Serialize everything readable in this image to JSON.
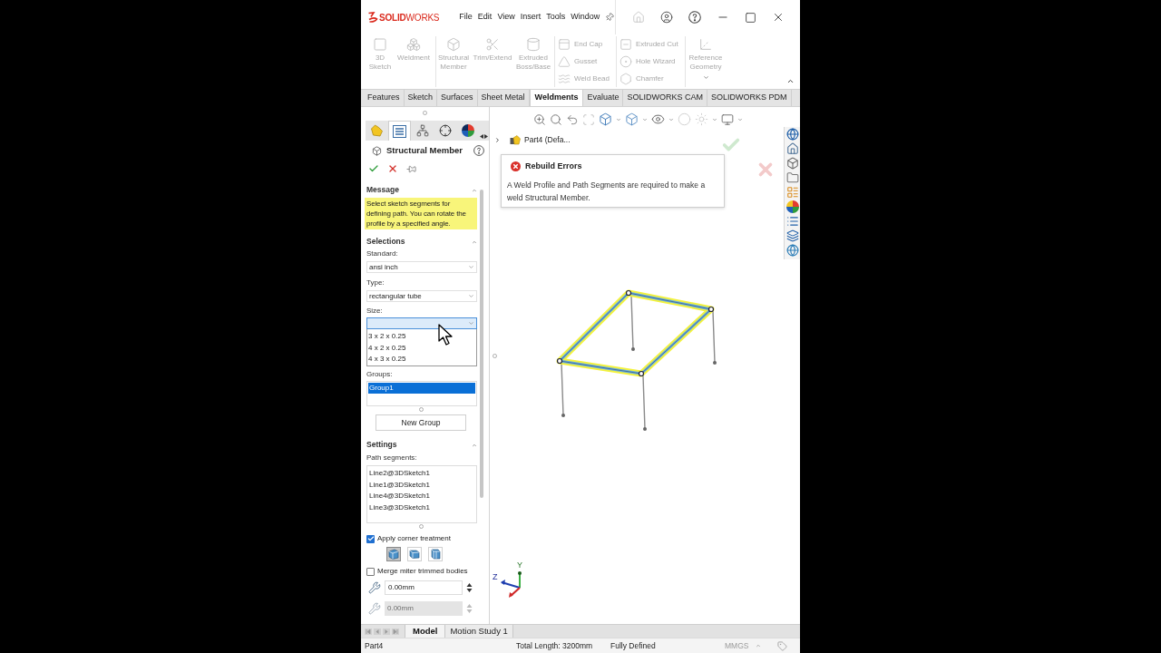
{
  "window": {
    "logo": "**SOLID**WORKS",
    "menu": [
      "File",
      "Edit",
      "View",
      "Insert",
      "Tools",
      "Window"
    ]
  },
  "command_manager": {
    "groups": [
      {
        "kind": "large",
        "tools": [
          {
            "label": "3D Sketch",
            "disabled": true,
            "dropdown": false
          },
          {
            "label": "Weldment",
            "disabled": true,
            "dropdown": false
          }
        ]
      },
      {
        "kind": "large",
        "tools": [
          {
            "label": "Structural Member",
            "disabled": true,
            "dropdown": false
          },
          {
            "label": "Trim/Extend",
            "disabled": true,
            "dropdown": false
          },
          {
            "label": "Extruded Boss/Base",
            "disabled": true,
            "dropdown": false
          }
        ]
      },
      {
        "kind": "stack",
        "tools": [
          {
            "label": "End Cap",
            "disabled": true,
            "dropdown": false
          },
          {
            "label": "Gusset",
            "disabled": true,
            "dropdown": false
          },
          {
            "label": "Weld Bead",
            "disabled": true,
            "dropdown": false
          }
        ]
      },
      {
        "kind": "stack",
        "tools": [
          {
            "label": "Extruded Cut",
            "disabled": true,
            "dropdown": false
          },
          {
            "label": "Hole Wizard",
            "disabled": true,
            "dropdown": false
          },
          {
            "label": "Chamfer",
            "disabled": true,
            "dropdown": false
          }
        ]
      },
      {
        "kind": "large",
        "tools": [
          {
            "label": "Reference Geometry",
            "disabled": true,
            "dropdown": true
          }
        ]
      }
    ],
    "tabs": [
      {
        "label": "Features",
        "selected": false
      },
      {
        "label": "Sketch",
        "selected": false
      },
      {
        "label": "Surfaces",
        "selected": false
      },
      {
        "label": "Sheet Metal",
        "selected": false
      },
      {
        "label": "Weldments",
        "selected": true
      },
      {
        "label": "Evaluate",
        "selected": false
      },
      {
        "label": "SOLIDWORKS CAM",
        "selected": false
      },
      {
        "label": "SOLIDWORKS PDM",
        "selected": false
      }
    ]
  },
  "panel": {
    "tabs": [
      {
        "kind": "feature_tree",
        "selected": false
      },
      {
        "kind": "property",
        "selected": true
      },
      {
        "kind": "configuration",
        "selected": false
      },
      {
        "kind": "dimxpert",
        "selected": false
      },
      {
        "kind": "display",
        "selected": false
      }
    ],
    "title": "Structural Member",
    "message": {
      "heading": "Message",
      "expanded": true,
      "text": "Select sketch segments for defining path. You can rotate the profile by a specified angle."
    },
    "selections": {
      "heading": "Selections",
      "expanded": true,
      "standard": {
        "label": "Standard:",
        "value": "ansi inch"
      },
      "type": {
        "label": "Type:",
        "value": "rectangular tube"
      },
      "size": {
        "label": "Size:",
        "open": true,
        "options": [
          "3 x 2 x 0.25",
          "4 x 2 x 0.25",
          "4 x 3 x 0.25"
        ]
      },
      "groups": {
        "label": "Groups:",
        "items": [
          {
            "label": "Group1",
            "selected": true
          }
        ]
      },
      "new_group_button": "New Group"
    },
    "settings": {
      "heading": "Settings",
      "expanded": true,
      "path_segments": {
        "label": "Path segments:",
        "items": [
          "Line2@3DSketch1",
          "Line1@3DSketch1",
          "Line4@3DSketch1",
          "Line3@3DSketch1"
        ]
      },
      "corner_treatment": {
        "label": "Apply corner treatment",
        "checked": true,
        "options": [
          {
            "kind": "end_miter",
            "selected": true
          },
          {
            "kind": "end_butt1",
            "selected": false
          },
          {
            "kind": "end_butt2",
            "selected": false
          }
        ]
      },
      "merge_miter": {
        "label": "Merge miter trimmed bodies",
        "checked": false
      },
      "gaps": [
        {
          "value": "0.00mm",
          "disabled": false
        },
        {
          "value": "0.00mm",
          "disabled": true
        }
      ]
    }
  },
  "graphics": {
    "tree_flyout": {
      "label": "Part4 (Defa...",
      "expanded": false
    },
    "error_popup": {
      "title": "Rebuild Errors",
      "text": "A Weld Profile and Path Segments are required to make a weld Structural Member."
    },
    "triad": {
      "y_label": "Y",
      "z_label": "Z"
    }
  },
  "bottom_tabs": [
    {
      "label": "Model",
      "selected": true
    },
    {
      "label": "Motion Study 1",
      "selected": false
    }
  ],
  "status_bar": {
    "document": "Part4",
    "length": "Total Length: 3200mm",
    "state": "Fully Defined",
    "units": "MMGS"
  }
}
